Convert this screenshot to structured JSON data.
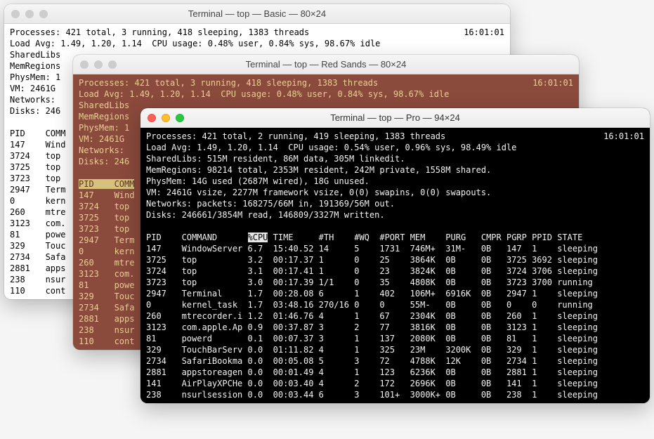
{
  "win1": {
    "title": "Terminal — top — Basic — 80×24",
    "header": {
      "procs": "Processes: 421 total, 3 running, 418 sleeping, 1383 threads",
      "time": "16:01:01",
      "load": "Load Avg: 1.49, 1.20, 1.14  CPU usage: 0.48% user, 0.84% sys, 98.67% idle",
      "shared": "SharedLibs",
      "memreg": "MemRegions",
      "phys": "PhysMem: 1",
      "vm": "VM: 2461G",
      "net": "Networks:",
      "disk": "Disks: 246"
    },
    "cols": "PID    COMM",
    "rows": [
      "147    Wind",
      "3724   top",
      "3725   top",
      "3723   top",
      "2947   Term",
      "0      kern",
      "260    mtre",
      "3123   com.",
      "81     powe",
      "329    Touc",
      "2734   Safa",
      "2881   apps",
      "238    nsur",
      "110    cont"
    ]
  },
  "win2": {
    "title": "Terminal — top — Red Sands — 80×24",
    "header": {
      "procs": "Processes: 421 total, 3 running, 418 sleeping, 1383 threads",
      "time": "16:01:01",
      "load": "Load Avg: 1.49, 1.20, 1.14  CPU usage: 0.48% user, 0.84% sys, 98.67% idle",
      "shared": "SharedLibs",
      "memreg": "MemRegions",
      "phys": "PhysMem: 1",
      "vm": "VM: 2461G",
      "net": "Networks:",
      "disk": "Disks: 246"
    },
    "cols_pid": "PID    COMM",
    "rows": [
      "147    Wind",
      "3724   top",
      "3725   top",
      "3723   top",
      "2947   Term",
      "0      kern",
      "260    mtre",
      "3123   com.",
      "81     powe",
      "329    Touc",
      "2734   Safa",
      "2881   apps",
      "238    nsur",
      "110    cont"
    ]
  },
  "win3": {
    "title": "Terminal — top — Pro — 94×24",
    "header": {
      "procs": "Processes: 421 total, 2 running, 419 sleeping, 1383 threads",
      "time": "16:01:01",
      "load": "Load Avg: 1.49, 1.20, 1.14  CPU usage: 0.54% user, 0.96% sys, 98.49% idle",
      "shared": "SharedLibs: 515M resident, 86M data, 305M linkedit.",
      "memreg": "MemRegions: 98214 total, 2353M resident, 242M private, 1558M shared.",
      "phys": "PhysMem: 14G used (2687M wired), 18G unused.",
      "vm": "VM: 2461G vsize, 2277M framework vsize, 0(0) swapins, 0(0) swapouts.",
      "net": "Networks: packets: 168275/66M in, 191369/56M out.",
      "disk": "Disks: 246661/3854M read, 146809/3327M written."
    },
    "cols": {
      "before_hl": "PID    COMMAND      ",
      "hl": "%CPU",
      "after_hl": " TIME     #TH    #WQ  #PORT MEM    PURG   CMPR PGRP PPID STATE"
    },
    "rows": [
      "147    WindowServer 6.7  15:40.52 14     5    1731  746M+  31M-   0B   147  1    sleeping",
      "3725   top          3.2  00:17.37 1      0    25    3864K  0B     0B   3725 3692 sleeping",
      "3724   top          3.1  00:17.41 1      0    23    3824K  0B     0B   3724 3706 sleeping",
      "3723   top          3.0  00:17.39 1/1    0    35    4808K  0B     0B   3723 3700 running",
      "2947   Terminal     1.7  00:28.08 6      1    402   106M+  6916K  0B   2947 1    sleeping",
      "0      kernel_task  1.7  03:48.16 270/16 0    0     55M-   0B     0B   0    0    running",
      "260    mtrecorder.i 1.2  01:46.76 4      1    67    2304K  0B     0B   260  1    sleeping",
      "3123   com.apple.Ap 0.9  00:37.87 3      2    77    3816K  0B     0B   3123 1    sleeping",
      "81     powerd       0.1  00:07.37 3      1    137   2080K  0B     0B   81   1    sleeping",
      "329    TouchBarServ 0.0  01:11.82 4      1    325   23M    3200K  0B   329  1    sleeping",
      "2734   SafariBookma 0.0  00:05.08 5      3    72    4788K  12K    0B   2734 1    sleeping",
      "2881   appstoreagen 0.0  00:01.49 4      1    123   6236K  0B     0B   2881 1    sleeping",
      "141    AirPlayXPCHe 0.0  00:03.40 4      2    172   2696K  0B     0B   141  1    sleeping",
      "238    nsurlsession 0.0  00:03.44 6      3    101+  3000K+ 0B     0B   238  1    sleeping"
    ]
  }
}
